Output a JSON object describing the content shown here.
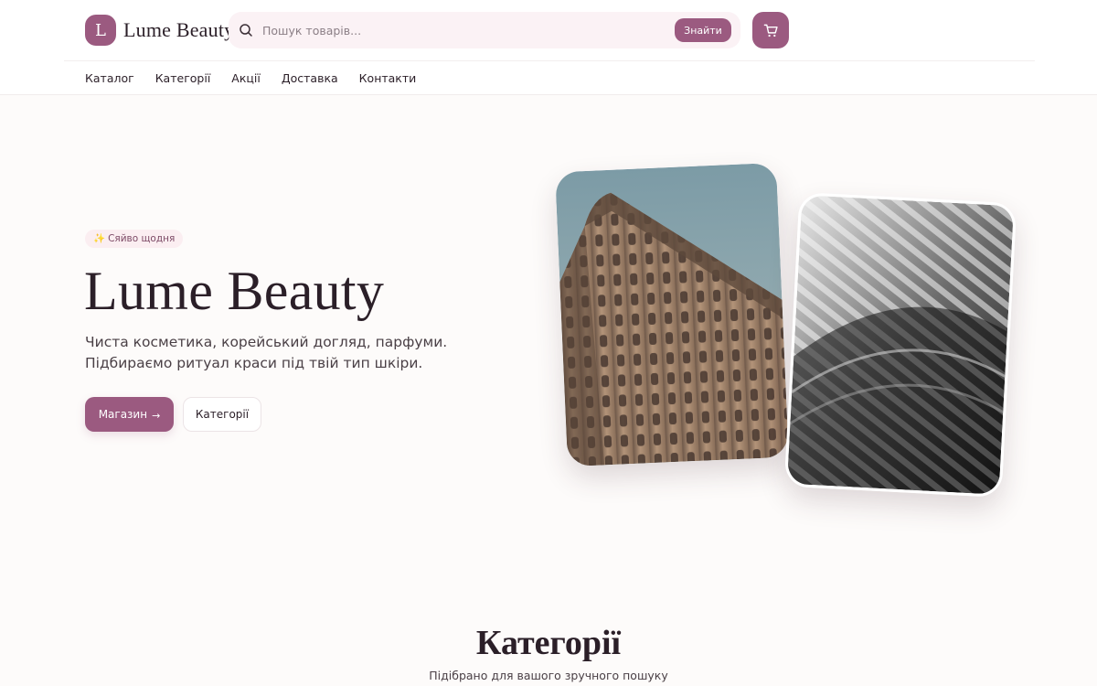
{
  "header": {
    "logo_letter": "L",
    "logo_text": "Lume Beauty",
    "search_placeholder": "Пошук товарів...",
    "search_button": "Знайти",
    "nav": [
      "Каталог",
      "Категорії",
      "Акції",
      "Доставка",
      "Контакти"
    ]
  },
  "hero": {
    "badge_icon": "sparkles-icon",
    "badge_text": "Сяйво щодня",
    "title": "Lume Beauty",
    "subtitle": "Чиста косметика, корейський догляд, парфуми. Підбираємо ритуал краси під твій тип шкіри.",
    "primary_button": "Магазин",
    "primary_button_arrow": "→",
    "secondary_button": "Категорії"
  },
  "categories": {
    "title": "Категорії",
    "subtitle": "Підібрано для вашого зручного пошуку"
  },
  "icons": {
    "search": "search-icon",
    "cart": "cart-icon"
  },
  "colors": {
    "accent": "#9b5a80",
    "text": "#2b1f28",
    "background": "#fdfbfa",
    "badge_bg": "#fbeef1"
  }
}
